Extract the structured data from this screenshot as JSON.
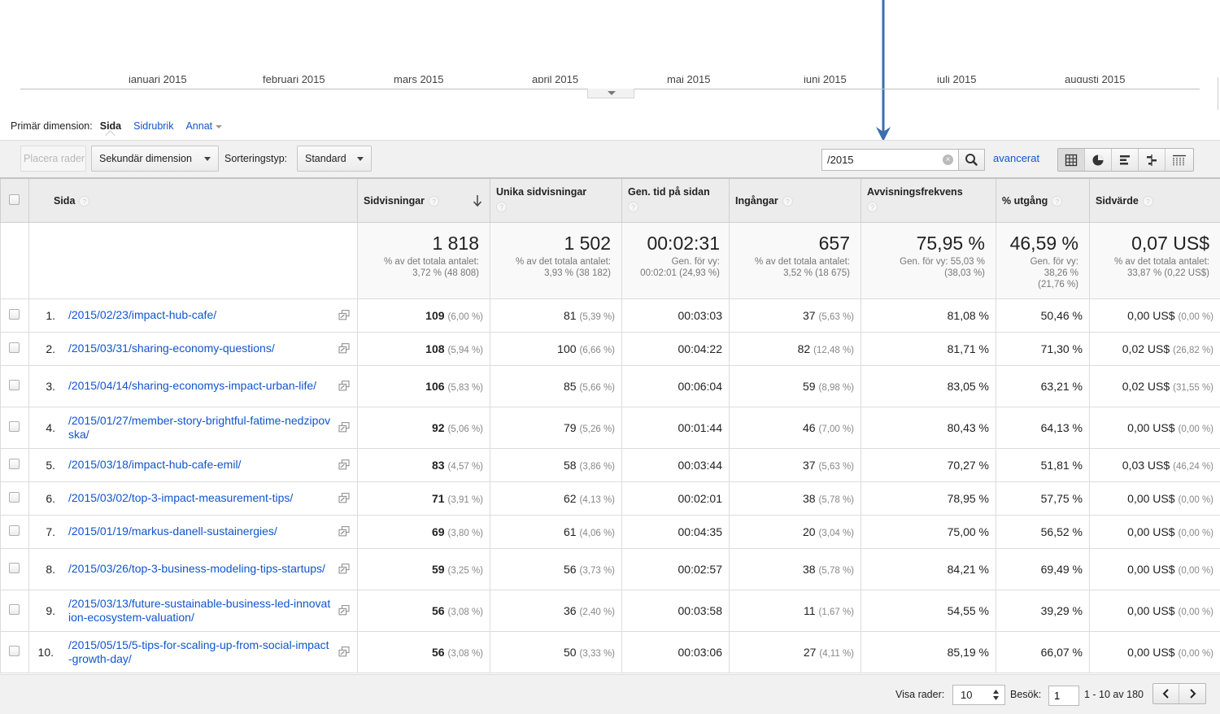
{
  "timeline": {
    "months": [
      "januari 2015",
      "februari 2015",
      "mars 2015",
      "april 2015",
      "maj 2015",
      "juni 2015",
      "juli 2015",
      "augusti 2015"
    ]
  },
  "dimension": {
    "label": "Primär dimension:",
    "active": "Sida",
    "links": [
      "Sidrubrik",
      "Annat"
    ]
  },
  "toolbar": {
    "place_rows": "Placera rader",
    "secondary_dimension": "Sekundär dimension",
    "sort_type_label": "Sorteringstyp:",
    "sort_type_value": "Standard",
    "search_value": "/2015",
    "advanced_link": "avancerat"
  },
  "icons": {
    "search": "search-icon",
    "clear": "clear-icon",
    "views": [
      "table-view-icon",
      "pie-view-icon",
      "bar-view-icon",
      "comparison-view-icon",
      "pivot-view-icon"
    ],
    "external": "open-external-icon",
    "sort": "sort-descending-icon",
    "help": "help-icon"
  },
  "colors": {
    "link": "#1155cc",
    "arrow": "#3b6fae",
    "header_bg": "#ececec",
    "toolbar_bg": "#f1f1f1"
  },
  "table": {
    "headers": {
      "page": "Sida",
      "pageviews": "Sidvisningar",
      "unique_pageviews": "Unika sidvisningar",
      "avg_time": "Gen. tid på sidan",
      "entrances": "Ingångar",
      "bounce_rate": "Avvisningsfrekvens",
      "exit_pct": "% utgång",
      "page_value": "Sidvärde"
    },
    "help_mark": "?",
    "totals": {
      "pageviews": {
        "value": "1 818",
        "sub1": "% av det totala antalet:",
        "sub2": "3,72 % (48 808)"
      },
      "unique_pageviews": {
        "value": "1 502",
        "sub1": "% av det totala antalet:",
        "sub2": "3,93 % (38 182)"
      },
      "avg_time": {
        "value": "00:02:31",
        "sub1": "Gen. för vy:",
        "sub2": "00:02:01 (24,93 %)"
      },
      "entrances": {
        "value": "657",
        "sub1": "% av det totala antalet:",
        "sub2": "3,52 % (18 675)"
      },
      "bounce_rate": {
        "value": "75,95 %",
        "sub1": "Gen. för vy: 55,03 %",
        "sub2": "(38,03 %)"
      },
      "exit_pct": {
        "value": "46,59 %",
        "sub1": "Gen. för vy:",
        "sub2": "38,26 %",
        "sub3": "(21,76 %)"
      },
      "page_value": {
        "value": "0,07 US$",
        "sub1": "% av det totala antalet:",
        "sub2": "33,87 % (0,22 US$)"
      }
    },
    "rows": [
      {
        "num": "1.",
        "url": "/2015/02/23/impact-hub-cafe/",
        "pv": "109",
        "pv_pct": "(6,00 %)",
        "upv": "81",
        "upv_pct": "(5,39 %)",
        "time": "00:03:03",
        "ent": "37",
        "ent_pct": "(5,63 %)",
        "bounce": "81,08 %",
        "exit": "50,46 %",
        "val": "0,00 US$",
        "val_pct": "(0,00 %)"
      },
      {
        "num": "2.",
        "url": "/2015/03/31/sharing-economy-questions/",
        "pv": "108",
        "pv_pct": "(5,94 %)",
        "upv": "100",
        "upv_pct": "(6,66 %)",
        "time": "00:04:22",
        "ent": "82",
        "ent_pct": "(12,48 %)",
        "bounce": "81,71 %",
        "exit": "71,30 %",
        "val": "0,02 US$",
        "val_pct": "(26,82 %)"
      },
      {
        "num": "3.",
        "url": "/2015/04/14/sharing-economys-impact-urban-life/",
        "pv": "106",
        "pv_pct": "(5,83 %)",
        "upv": "85",
        "upv_pct": "(5,66 %)",
        "time": "00:06:04",
        "ent": "59",
        "ent_pct": "(8,98 %)",
        "bounce": "83,05 %",
        "exit": "63,21 %",
        "val": "0,02 US$",
        "val_pct": "(31,55 %)"
      },
      {
        "num": "4.",
        "url": "/2015/01/27/member-story-brightful-fatime-nedzipovska/",
        "pv": "92",
        "pv_pct": "(5,06 %)",
        "upv": "79",
        "upv_pct": "(5,26 %)",
        "time": "00:01:44",
        "ent": "46",
        "ent_pct": "(7,00 %)",
        "bounce": "80,43 %",
        "exit": "64,13 %",
        "val": "0,00 US$",
        "val_pct": "(0,00 %)"
      },
      {
        "num": "5.",
        "url": "/2015/03/18/impact-hub-cafe-emil/",
        "pv": "83",
        "pv_pct": "(4,57 %)",
        "upv": "58",
        "upv_pct": "(3,86 %)",
        "time": "00:03:44",
        "ent": "37",
        "ent_pct": "(5,63 %)",
        "bounce": "70,27 %",
        "exit": "51,81 %",
        "val": "0,03 US$",
        "val_pct": "(46,24 %)"
      },
      {
        "num": "6.",
        "url": "/2015/03/02/top-3-impact-measurement-tips/",
        "pv": "71",
        "pv_pct": "(3,91 %)",
        "upv": "62",
        "upv_pct": "(4,13 %)",
        "time": "00:02:01",
        "ent": "38",
        "ent_pct": "(5,78 %)",
        "bounce": "78,95 %",
        "exit": "57,75 %",
        "val": "0,00 US$",
        "val_pct": "(0,00 %)"
      },
      {
        "num": "7.",
        "url": "/2015/01/19/markus-danell-sustainergies/",
        "pv": "69",
        "pv_pct": "(3,80 %)",
        "upv": "61",
        "upv_pct": "(4,06 %)",
        "time": "00:04:35",
        "ent": "20",
        "ent_pct": "(3,04 %)",
        "bounce": "75,00 %",
        "exit": "56,52 %",
        "val": "0,00 US$",
        "val_pct": "(0,00 %)"
      },
      {
        "num": "8.",
        "url": "/2015/03/26/top-3-business-modeling-tips-startups/",
        "pv": "59",
        "pv_pct": "(3,25 %)",
        "upv": "56",
        "upv_pct": "(3,73 %)",
        "time": "00:02:57",
        "ent": "38",
        "ent_pct": "(5,78 %)",
        "bounce": "84,21 %",
        "exit": "69,49 %",
        "val": "0,00 US$",
        "val_pct": "(0,00 %)"
      },
      {
        "num": "9.",
        "url": "/2015/03/13/future-sustainable-business-led-innovation-ecosystem-valuation/",
        "pv": "56",
        "pv_pct": "(3,08 %)",
        "upv": "36",
        "upv_pct": "(2,40 %)",
        "time": "00:03:58",
        "ent": "11",
        "ent_pct": "(1,67 %)",
        "bounce": "54,55 %",
        "exit": "39,29 %",
        "val": "0,00 US$",
        "val_pct": "(0,00 %)"
      },
      {
        "num": "10.",
        "url": "/2015/05/15/5-tips-for-scaling-up-from-social-impact-growth-day/",
        "pv": "56",
        "pv_pct": "(3,08 %)",
        "upv": "50",
        "upv_pct": "(3,33 %)",
        "time": "00:03:06",
        "ent": "27",
        "ent_pct": "(4,11 %)",
        "bounce": "85,19 %",
        "exit": "66,07 %",
        "val": "0,00 US$",
        "val_pct": "(0,00 %)"
      }
    ]
  },
  "footer": {
    "show_rows_label": "Visa rader:",
    "show_rows_value": "10",
    "goto_label": "Besök:",
    "goto_value": "1",
    "range": "1 - 10 av 180"
  }
}
